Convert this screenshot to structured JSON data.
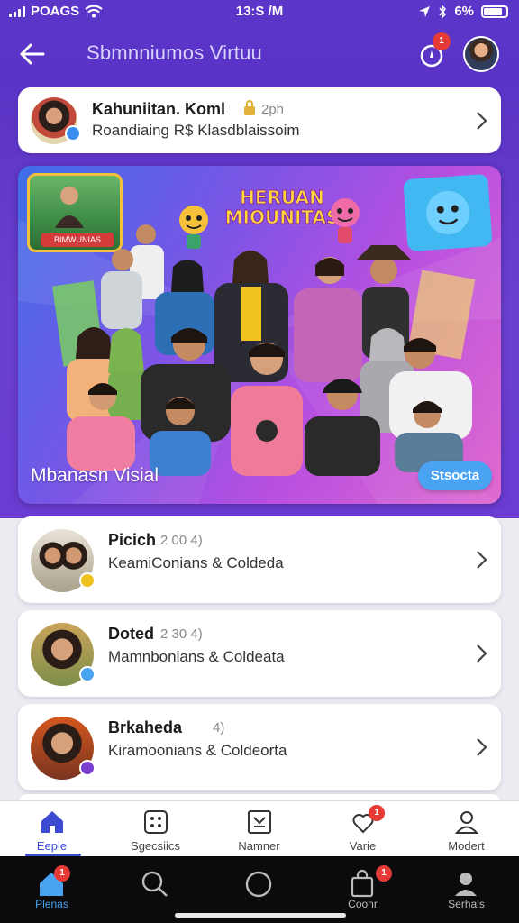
{
  "status_bar": {
    "carrier": "POAGS",
    "time": "13:S /M",
    "battery": "6%"
  },
  "header": {
    "title": "Sbmnniumos Virtuu",
    "bell_badge": "1"
  },
  "featured_card": {
    "name": "Kahuniitan. Koml",
    "meta": "2ph",
    "subtitle": "Roandiaing R$ Klasdblaissoim"
  },
  "banner": {
    "logo_line1": "HERUAN",
    "logo_line2": "MIOUNITAS",
    "photo_tag": "BIMWUNIAS",
    "caption": "Mbanasn Visial",
    "button_label": "Stsocta"
  },
  "list": [
    {
      "name": "Picich",
      "meta": "2  00 4)",
      "subtitle": "KeamiConians & Coldeda",
      "badge_color": "#f0c21f"
    },
    {
      "name": "Doted",
      "meta": "2  30 4)",
      "subtitle": "Mamnbonians & Coldeata",
      "badge_color": "#4aa3f0"
    },
    {
      "name": "Brkaheda",
      "meta": "4)",
      "subtitle": "Kiramoonians & Coldeorta",
      "badge_color": "#7a3fd0"
    }
  ],
  "bottom_nav": [
    {
      "label": "Eeple",
      "icon": "home-icon",
      "active": true
    },
    {
      "label": "Sgecsiics",
      "icon": "calendar-grid-icon",
      "active": false
    },
    {
      "label": "Namner",
      "icon": "id-card-icon",
      "active": false
    },
    {
      "label": "Varie",
      "icon": "heart-chat-icon",
      "active": false,
      "badge": "1"
    },
    {
      "label": "Modert",
      "icon": "profile-icon",
      "active": false
    }
  ],
  "system_bar": [
    {
      "label": "Plenas",
      "icon": "home-icon",
      "badge": "1"
    },
    {
      "label": "",
      "icon": "search-icon"
    },
    {
      "label": "",
      "icon": "circle-icon"
    },
    {
      "label": "Coonr",
      "icon": "bag-icon",
      "badge": "1"
    },
    {
      "label": "Serhais",
      "icon": "person-icon"
    }
  ],
  "colors": {
    "header_bg": "#5a36c9",
    "accent": "#3d4bd1",
    "badge_red": "#e53a35"
  }
}
